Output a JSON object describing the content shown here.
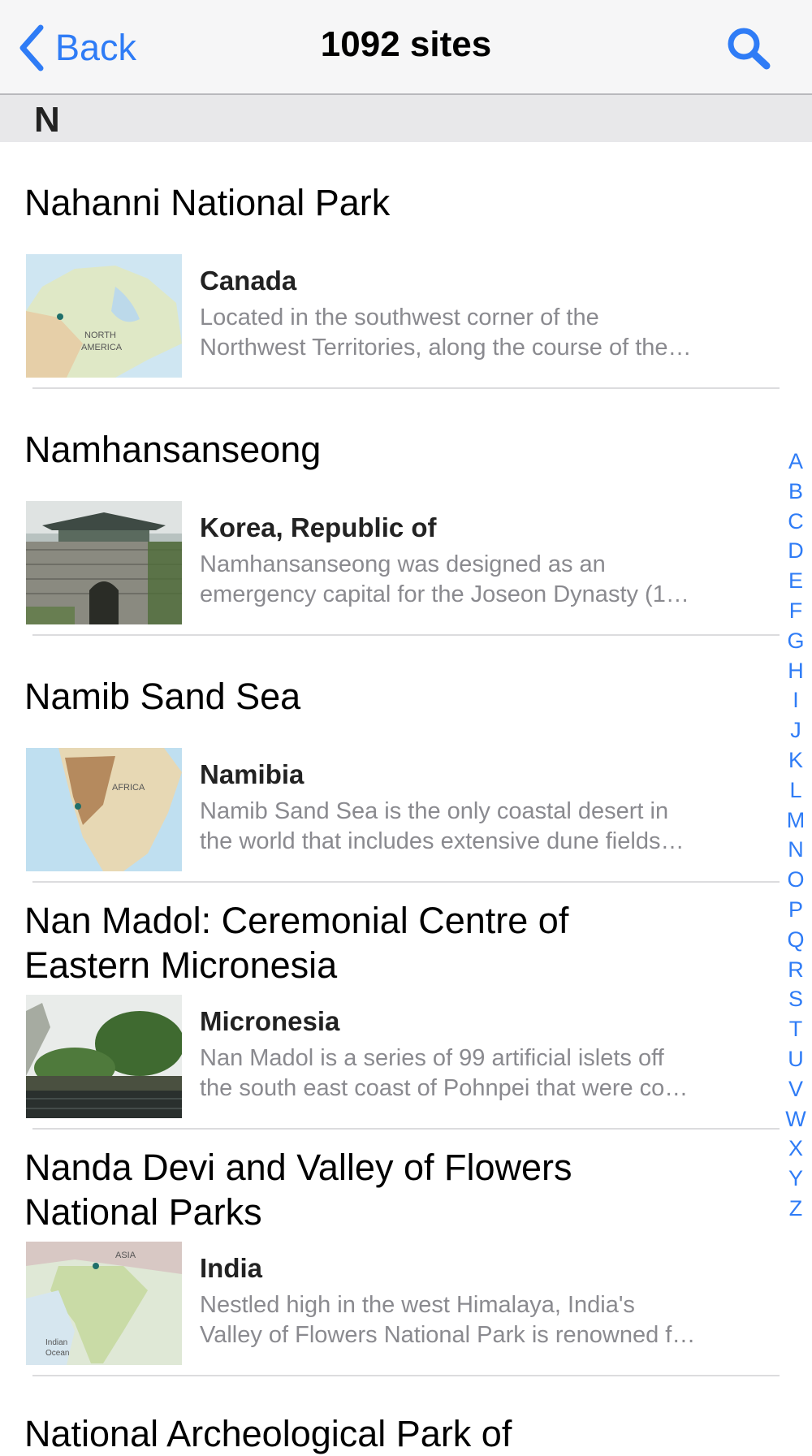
{
  "nav": {
    "back_label": "Back",
    "title": "1092 sites",
    "search_icon": "search-icon",
    "accent": "#2f7cf6"
  },
  "section": {
    "letter": "N"
  },
  "sites": [
    {
      "name": "Nahanni National Park",
      "country": "Canada",
      "desc_line1": "Located in the southwest corner of the",
      "desc_line2": "Northwest Territories, along the course of the…",
      "thumb": {
        "type": "map",
        "label1": "NORTH",
        "label2": "AMERICA"
      }
    },
    {
      "name": "Namhansanseong",
      "country": "Korea, Republic of",
      "desc_line1": "Namhansanseong was designed as an",
      "desc_line2": "emergency capital for the Joseon Dynasty (1…",
      "thumb": {
        "type": "photo"
      }
    },
    {
      "name": "Namib Sand Sea",
      "country": "Namibia",
      "desc_line1": "Namib Sand Sea is the only coastal desert in",
      "desc_line2": "the world that includes extensive dune fields…",
      "thumb": {
        "type": "map",
        "label1": "AFRICA"
      }
    },
    {
      "name": "Nan Madol: Ceremonial Centre of Eastern Micronesia",
      "country": "Micronesia",
      "desc_line1": "Nan Madol is a series of 99 artificial islets off",
      "desc_line2": "the south east coast of Pohnpei that were co…",
      "thumb": {
        "type": "photo"
      }
    },
    {
      "name": "Nanda Devi and Valley of Flowers National Parks",
      "country": "India",
      "desc_line1": "Nestled high in the west Himalaya, India's",
      "desc_line2": "Valley of Flowers National Park is renowned f…",
      "thumb": {
        "type": "map",
        "label1": "ASIA",
        "label2": "Indian",
        "label3": "Ocean"
      }
    }
  ],
  "partial_site": {
    "name": "National Archeological Park of"
  },
  "index_letters": [
    "A",
    "B",
    "C",
    "D",
    "E",
    "F",
    "G",
    "H",
    "I",
    "J",
    "K",
    "L",
    "M",
    "N",
    "O",
    "P",
    "Q",
    "R",
    "S",
    "T",
    "U",
    "V",
    "W",
    "X",
    "Y",
    "Z"
  ]
}
